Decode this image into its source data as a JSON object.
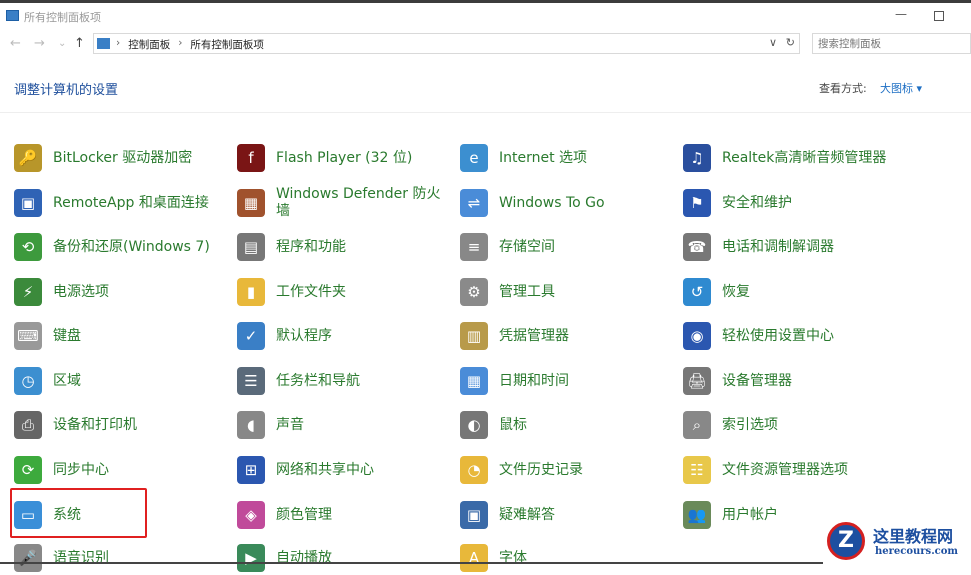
{
  "window": {
    "title": "所有控制面板项"
  },
  "nav": {
    "back": "←",
    "forward": "→",
    "recent": "⌄",
    "up": "↑"
  },
  "address": {
    "crumbs": [
      "控制面板",
      "所有控制面板项"
    ],
    "separator": "›",
    "dropdown": "∨",
    "refresh": "↻"
  },
  "search": {
    "placeholder": "搜索控制面板"
  },
  "header": {
    "title": "调整计算机的设置",
    "view_by_label": "查看方式:",
    "view_by_value": "大图标 ▾"
  },
  "items": [
    {
      "label": "BitLocker 驱动器加密",
      "icon": "lock-key-icon",
      "color": "#b8962a",
      "glyph": "🔑"
    },
    {
      "label": "Flash Player (32 位)",
      "icon": "flash-icon",
      "color": "#7a1515",
      "glyph": "f"
    },
    {
      "label": "Internet 选项",
      "icon": "globe-icon",
      "color": "#3c8fd0",
      "glyph": "e"
    },
    {
      "label": "Realtek高清晰音频管理器",
      "icon": "audio-manager-icon",
      "color": "#2a4f9e",
      "glyph": "♫"
    },
    {
      "label": "RemoteApp 和桌面连接",
      "icon": "remote-desktop-icon",
      "color": "#2f63b5",
      "glyph": "▣"
    },
    {
      "label": "Windows Defender 防火墙",
      "icon": "firewall-icon",
      "color": "#a0522d",
      "glyph": "▦"
    },
    {
      "label": "Windows To Go",
      "icon": "usb-icon",
      "color": "#4a8cd8",
      "glyph": "⇌"
    },
    {
      "label": "安全和维护",
      "icon": "flag-icon",
      "color": "#2b57b0",
      "glyph": "⚑"
    },
    {
      "label": "备份和还原(Windows 7)",
      "icon": "backup-icon",
      "color": "#3d9a3d",
      "glyph": "⟲"
    },
    {
      "label": "程序和功能",
      "icon": "programs-icon",
      "color": "#777",
      "glyph": "▤"
    },
    {
      "label": "存储空间",
      "icon": "storage-icon",
      "color": "#888",
      "glyph": "≡"
    },
    {
      "label": "电话和调制解调器",
      "icon": "phone-icon",
      "color": "#777",
      "glyph": "☎"
    },
    {
      "label": "电源选项",
      "icon": "power-icon",
      "color": "#3b8a3b",
      "glyph": "⚡"
    },
    {
      "label": "工作文件夹",
      "icon": "work-folder-icon",
      "color": "#e8b83a",
      "glyph": "▮"
    },
    {
      "label": "管理工具",
      "icon": "admin-tools-icon",
      "color": "#8a8a8a",
      "glyph": "⚙"
    },
    {
      "label": "恢复",
      "icon": "recovery-icon",
      "color": "#2f8ad0",
      "glyph": "↺"
    },
    {
      "label": "键盘",
      "icon": "keyboard-icon",
      "color": "#999",
      "glyph": "⌨"
    },
    {
      "label": "默认程序",
      "icon": "default-programs-icon",
      "color": "#3a7fc6",
      "glyph": "✓"
    },
    {
      "label": "凭据管理器",
      "icon": "credential-icon",
      "color": "#b89a4a",
      "glyph": "▥"
    },
    {
      "label": "轻松使用设置中心",
      "icon": "ease-of-access-icon",
      "color": "#2b57b0",
      "glyph": "◉"
    },
    {
      "label": "区域",
      "icon": "region-icon",
      "color": "#3c8fd0",
      "glyph": "◷"
    },
    {
      "label": "任务栏和导航",
      "icon": "taskbar-icon",
      "color": "#5a6a7a",
      "glyph": "☰"
    },
    {
      "label": "日期和时间",
      "icon": "calendar-icon",
      "color": "#4a8cd8",
      "glyph": "▦"
    },
    {
      "label": "设备管理器",
      "icon": "device-manager-icon",
      "color": "#777",
      "glyph": "🖨"
    },
    {
      "label": "设备和打印机",
      "icon": "printer-icon",
      "color": "#666",
      "glyph": "⎙"
    },
    {
      "label": "声音",
      "icon": "speaker-icon",
      "color": "#888",
      "glyph": "◖"
    },
    {
      "label": "鼠标",
      "icon": "mouse-icon",
      "color": "#777",
      "glyph": "◐"
    },
    {
      "label": "索引选项",
      "icon": "index-search-icon",
      "color": "#888",
      "glyph": "⌕"
    },
    {
      "label": "同步中心",
      "icon": "sync-icon",
      "color": "#3daa3d",
      "glyph": "⟳"
    },
    {
      "label": "网络和共享中心",
      "icon": "network-icon",
      "color": "#2b57b0",
      "glyph": "⊞"
    },
    {
      "label": "文件历史记录",
      "icon": "file-history-icon",
      "color": "#e8b83a",
      "glyph": "◔"
    },
    {
      "label": "文件资源管理器选项",
      "icon": "folder-options-icon",
      "color": "#e8c84a",
      "glyph": "☷"
    },
    {
      "label": "系统",
      "icon": "system-icon",
      "color": "#3a8fd8",
      "glyph": "▭"
    },
    {
      "label": "颜色管理",
      "icon": "color-management-icon",
      "color": "#c04a9a",
      "glyph": "◈"
    },
    {
      "label": "疑难解答",
      "icon": "troubleshoot-icon",
      "color": "#3a6aa8",
      "glyph": "▣"
    },
    {
      "label": "用户帐户",
      "icon": "users-icon",
      "color": "#6a8a5a",
      "glyph": "👥"
    },
    {
      "label": "语音识别",
      "icon": "microphone-icon",
      "color": "#888",
      "glyph": "🎤"
    },
    {
      "label": "自动播放",
      "icon": "autoplay-icon",
      "color": "#3a8a5a",
      "glyph": "▶"
    },
    {
      "label": "字体",
      "icon": "fonts-icon",
      "color": "#e8b83a",
      "glyph": "A"
    }
  ],
  "watermark": {
    "title": "这里教程网",
    "site": "herecours.com",
    "logo": "Z"
  }
}
